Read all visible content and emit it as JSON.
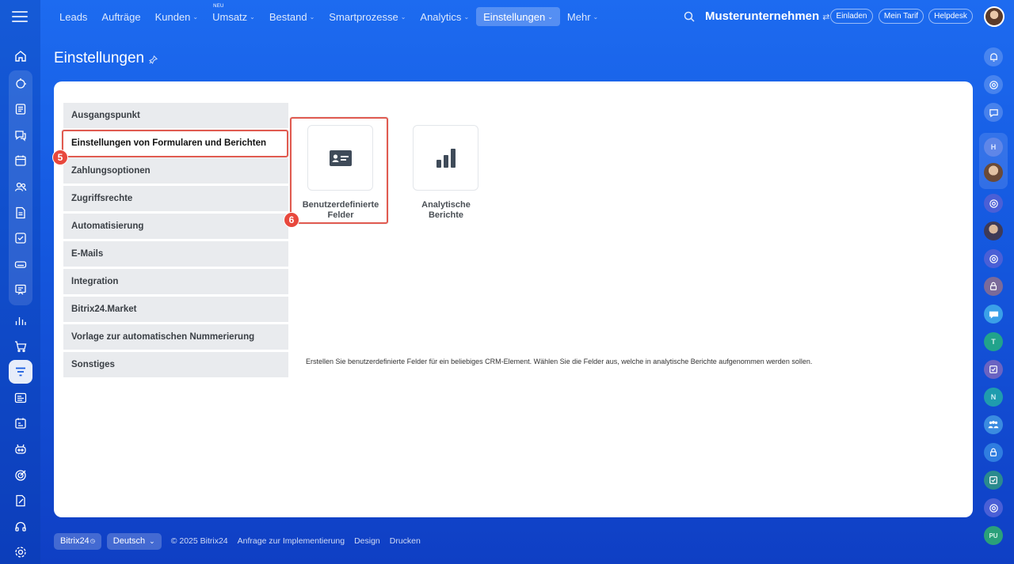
{
  "nav": {
    "items": [
      {
        "label": "Leads",
        "chevron": false
      },
      {
        "label": "Aufträge",
        "chevron": false
      },
      {
        "label": "Kunden",
        "chevron": true
      },
      {
        "label": "Umsatz",
        "chevron": true,
        "badge": "NEU"
      },
      {
        "label": "Bestand",
        "chevron": true
      },
      {
        "label": "Smartprozesse",
        "chevron": true
      },
      {
        "label": "Analytics",
        "chevron": true
      },
      {
        "label": "Einstellungen",
        "chevron": true,
        "active": true
      },
      {
        "label": "Mehr",
        "chevron": true
      }
    ]
  },
  "header": {
    "company": "Musterunternehmen",
    "invite": "Einladen",
    "plan": "Mein Tarif",
    "helpdesk": "Helpdesk"
  },
  "page": {
    "title": "Einstellungen"
  },
  "menu": {
    "items": [
      "Ausgangspunkt",
      "Einstellungen von Formularen und Berichten",
      "Zahlungsoptionen",
      "Zugriffsrechte",
      "Automatisierung",
      "E-Mails",
      "Integration",
      "Bitrix24.Market",
      "Vorlage zur automatischen Nummerierung",
      "Sonstiges"
    ],
    "active_index": 1
  },
  "annotations": {
    "step5": "5",
    "step6": "6"
  },
  "tiles": [
    {
      "label_line1": "Benutzerdefinierte",
      "label_line2": "Felder",
      "icon": "id-card-icon"
    },
    {
      "label_line1": "Analytische",
      "label_line2": "Berichte",
      "icon": "bar-chart-icon"
    }
  ],
  "description": "Erstellen Sie benutzerdefinierte Felder für ein beliebiges CRM-Element. Wählen Sie die Felder aus, welche in analytische Berichte aufgenommen werden sollen.",
  "footer": {
    "brand": "Bitrix24",
    "language": "Deutsch",
    "copyright": "© 2025 Bitrix24",
    "link_impl": "Anfrage zur Implementierung",
    "link_design": "Design",
    "link_print": "Drucken"
  },
  "right_bar": {
    "avatars": [
      "H",
      "T",
      "N",
      "PU"
    ]
  },
  "colors": {
    "accent_red": "#e8483d",
    "background_blue": "#1559e0"
  }
}
